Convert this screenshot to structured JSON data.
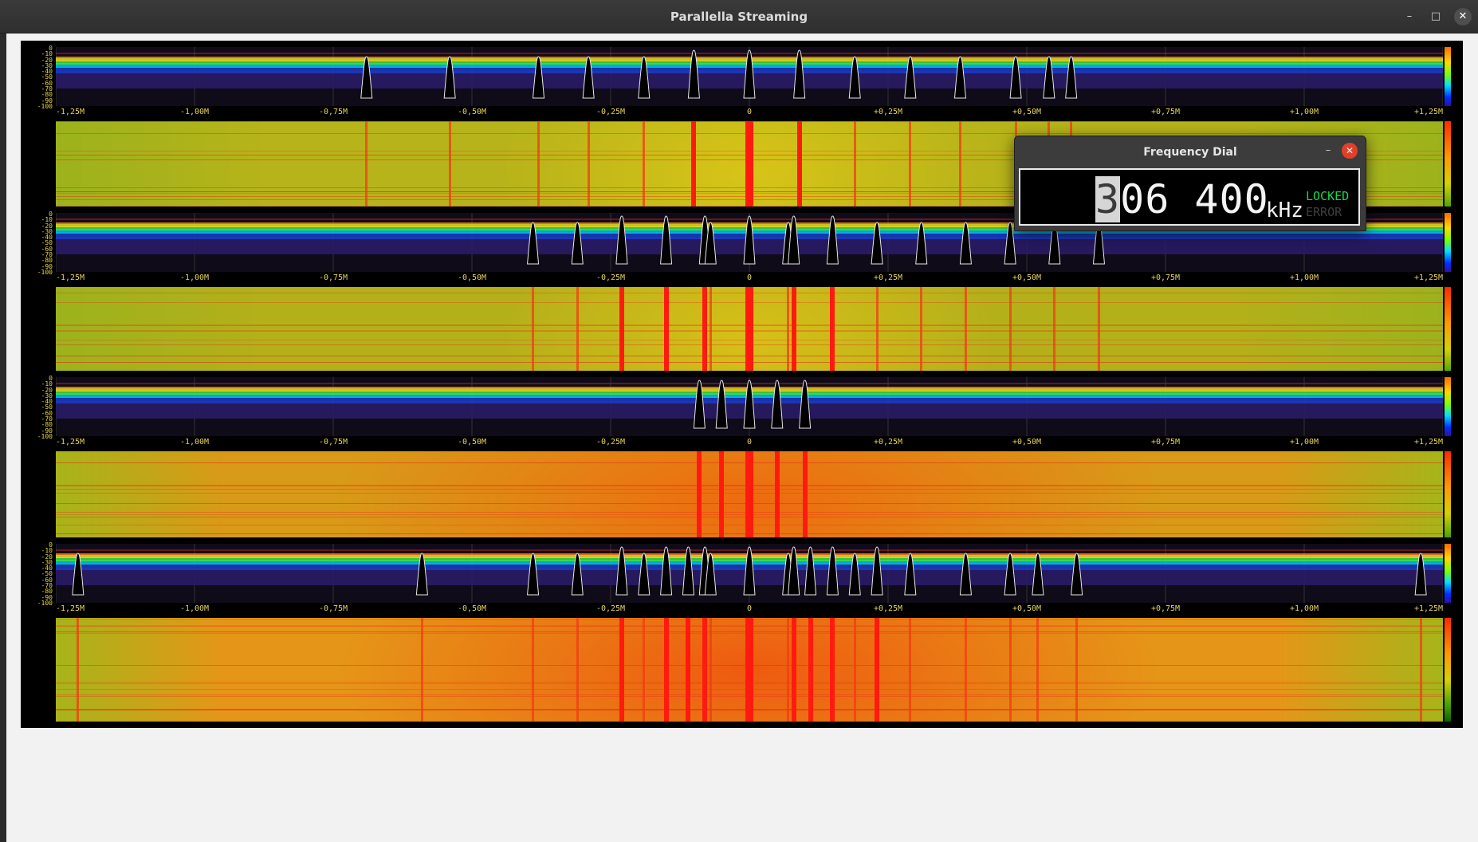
{
  "window": {
    "title": "Parallella Streaming",
    "minimize_icon": "minimize-icon",
    "maximize_icon": "maximize-icon",
    "close_icon": "close-icon"
  },
  "db_scale": [
    "0",
    "-10",
    "-20",
    "-30",
    "-40",
    "-50",
    "-60",
    "-70",
    "-80",
    "-90",
    "-100"
  ],
  "freq_axis": [
    "-1,25M",
    "-1,00M",
    "-0,75M",
    "-0,50M",
    "-0,25M",
    "0",
    "+0,25M",
    "+0,50M",
    "+0,75M",
    "+1,00M",
    "+1,25M"
  ],
  "panels": [
    {
      "wf_base": "#b7b31a",
      "wf_hot": "#d8c418",
      "peaks": [
        -0.69,
        -0.54,
        -0.38,
        -0.29,
        -0.19,
        -0.1,
        0,
        0.09,
        0.19,
        0.29,
        0.38,
        0.48,
        0.54,
        0.58
      ],
      "strong": [
        -0.1,
        0,
        0.09
      ]
    },
    {
      "wf_base": "#b4b01a",
      "wf_hot": "#d8bf18",
      "peaks": [
        -0.39,
        -0.31,
        -0.23,
        -0.15,
        -0.08,
        -0.07,
        0,
        0.07,
        0.08,
        0.15,
        0.23,
        0.31,
        0.39,
        0.47,
        0.55,
        0.63
      ],
      "strong": [
        -0.23,
        -0.15,
        -0.08,
        0,
        0.08,
        0.15
      ]
    },
    {
      "wf_base": "#d89a18",
      "wf_hot": "#ef6a10",
      "peaks": [
        -0.09,
        -0.05,
        0,
        0.05,
        0.1
      ],
      "strong": [
        -0.09,
        -0.05,
        0,
        0.05,
        0.1
      ]
    },
    {
      "wf_base": "#e59618",
      "wf_hot": "#ef5a10",
      "peaks": [
        -1.21,
        -0.59,
        -0.39,
        -0.31,
        -0.23,
        -0.19,
        -0.15,
        -0.11,
        -0.08,
        -0.07,
        0,
        0.07,
        0.08,
        0.11,
        0.15,
        0.19,
        0.23,
        0.29,
        0.39,
        0.47,
        0.52,
        0.59,
        1.21
      ],
      "strong": [
        -0.23,
        -0.15,
        -0.11,
        -0.08,
        0,
        0.08,
        0.11,
        0.15,
        0.23
      ]
    }
  ],
  "dial": {
    "title": "Frequency Dial",
    "minimize_icon": "minimize-icon",
    "close_icon": "close-icon",
    "digit_cursor": "3",
    "digits_rest": "06 400",
    "unit": "kHz",
    "status_locked": "LOCKED",
    "status_error": "ERROR"
  }
}
